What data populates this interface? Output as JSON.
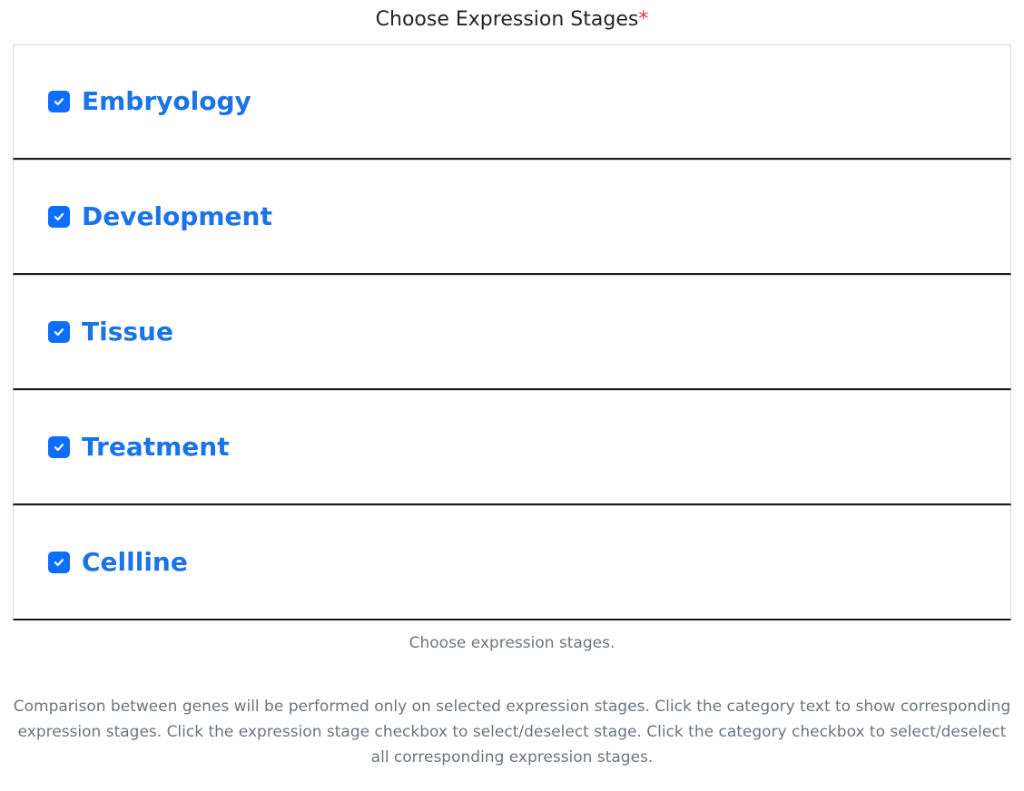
{
  "form": {
    "title": "Choose Expression Stages",
    "required_marker": "*"
  },
  "stages": [
    {
      "label": "Embryology",
      "checked": true
    },
    {
      "label": "Development",
      "checked": true
    },
    {
      "label": "Tissue",
      "checked": true
    },
    {
      "label": "Treatment",
      "checked": true
    },
    {
      "label": "Cellline",
      "checked": true
    }
  ],
  "help": {
    "short": "Choose expression stages.",
    "long": "Comparison between genes will be performed only on selected expression stages. Click the category text to show corresponding expression stages. Click the expression stage checkbox to select/deselect stage. Click the category checkbox to select/deselect all corresponding expression stages."
  },
  "colors": {
    "accent": "#0d6efd",
    "label": "#1a73e8",
    "required": "#dc3545",
    "muted": "#6c757d"
  },
  "icons": {
    "checkbox": "check-icon"
  }
}
